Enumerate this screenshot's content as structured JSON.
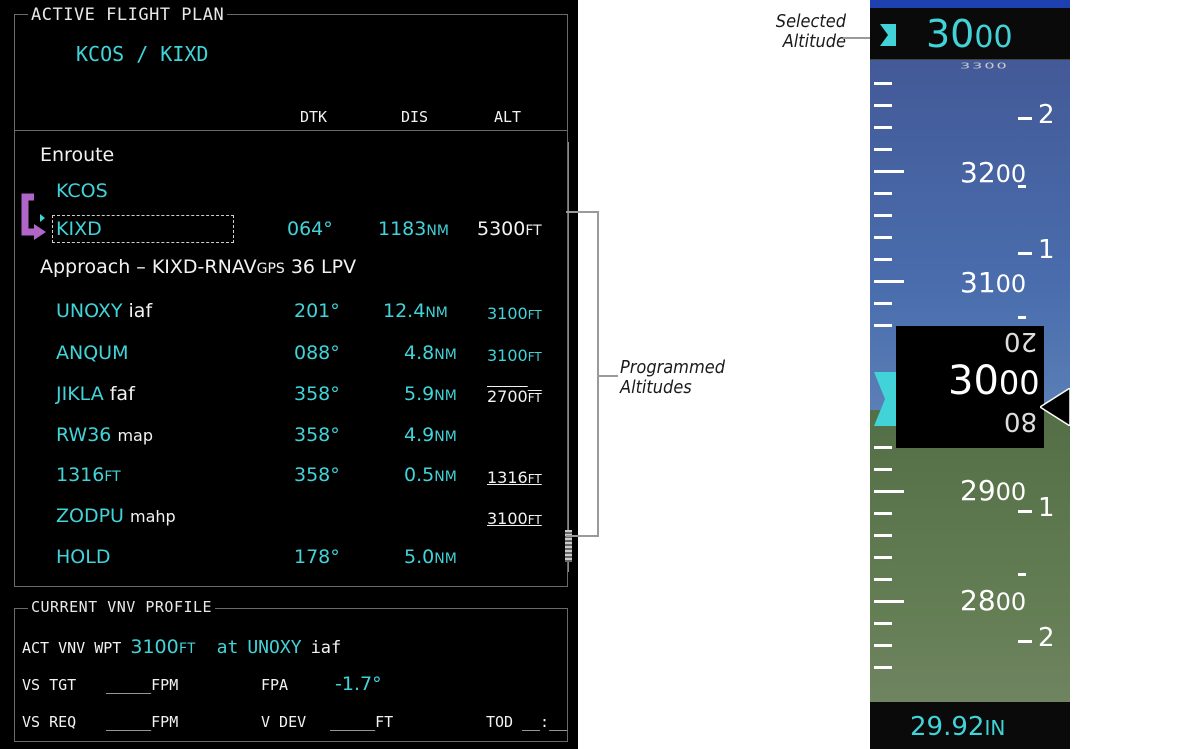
{
  "flight_plan": {
    "title": "ACTIVE FLIGHT PLAN",
    "route": "KCOS / KIXD",
    "headers": {
      "dtk": "DTK",
      "dis": "DIS",
      "alt": "ALT"
    },
    "enroute_label": "Enroute",
    "rows": [
      {
        "name": "KCOS",
        "suffix": "",
        "dtk": "",
        "dis": "",
        "dis_unit": "",
        "alt": "",
        "alt_unit": ""
      },
      {
        "name": "KIXD",
        "suffix": "",
        "dtk": "064°",
        "dis": "1183",
        "dis_unit": "NM",
        "alt": "5300",
        "alt_unit": "FT"
      }
    ],
    "approach_label": "Approach – KIXD-RNAV",
    "approach_gps": "GPS",
    "approach_tail": " 36 LPV",
    "approach_rows": [
      {
        "name": "UNOXY",
        "suffix": "iaf",
        "dtk": "201°",
        "dis": "12.4",
        "dis_unit": "NM",
        "alt": "3100",
        "alt_unit": "FT"
      },
      {
        "name": "ANQUM",
        "suffix": "",
        "dtk": "088°",
        "dis": "4.8",
        "dis_unit": "NM",
        "alt": "3100",
        "alt_unit": "FT"
      },
      {
        "name": "JIKLA",
        "suffix": "faf",
        "dtk": "358°",
        "dis": "5.9",
        "dis_unit": "NM",
        "alt": "2700",
        "alt_unit": "FT"
      },
      {
        "name": "RW36",
        "suffix": "map",
        "dtk": "358°",
        "dis": "4.9",
        "dis_unit": "NM",
        "alt": "",
        "alt_unit": ""
      },
      {
        "name": "1316",
        "suffix": "FT",
        "dtk": "358°",
        "dis": "0.5",
        "dis_unit": "NM",
        "alt": "1316",
        "alt_unit": "FT"
      },
      {
        "name": "ZODPU",
        "suffix": "mahp",
        "dtk": "",
        "dis": "",
        "dis_unit": "",
        "alt": "3100",
        "alt_unit": "FT"
      },
      {
        "name": "HOLD",
        "suffix": "",
        "dtk": "178°",
        "dis": "5.0",
        "dis_unit": "NM",
        "alt": "",
        "alt_unit": ""
      }
    ]
  },
  "vnv_profile": {
    "title": "CURRENT VNV PROFILE",
    "act_label": "ACT VNV WPT",
    "act_value": "3100",
    "act_unit": "FT",
    "at_label": "at",
    "at_wpt": "UNOXY",
    "at_suffix": "iaf",
    "vs_tgt_label": "VS TGT",
    "vs_tgt_value": "_____FPM",
    "fpa_label": "FPA",
    "fpa_value": "-1.7°",
    "vs_req_label": "VS REQ",
    "vs_req_value": "_____FPM",
    "vdev_label": "V DEV",
    "vdev_value": "_____FT",
    "tod_label": "TOD",
    "tod_value": "__:__"
  },
  "callouts": {
    "programmed": [
      "Programmed",
      "Altitudes"
    ],
    "selected": [
      "Selected",
      "Altitude"
    ]
  },
  "pfd": {
    "selected_alt_big": "30",
    "selected_alt_small": "00",
    "tape_labels": [
      {
        "big": "32",
        "small": "00"
      },
      {
        "big": "31",
        "small": "00"
      },
      {
        "big": "29",
        "small": "00"
      },
      {
        "big": "28",
        "small": "00"
      }
    ],
    "current_alt_big": "30",
    "current_alt_small": "00",
    "roll_above": "20",
    "roll_below": "80",
    "vs_labels": [
      "2",
      "1",
      "1",
      "2"
    ],
    "baro": "29.92",
    "baro_unit": "IN",
    "colors": {
      "cyan": "#41d3d8",
      "sky": "#2c6ce0",
      "ground": "#5c8a3f"
    }
  }
}
